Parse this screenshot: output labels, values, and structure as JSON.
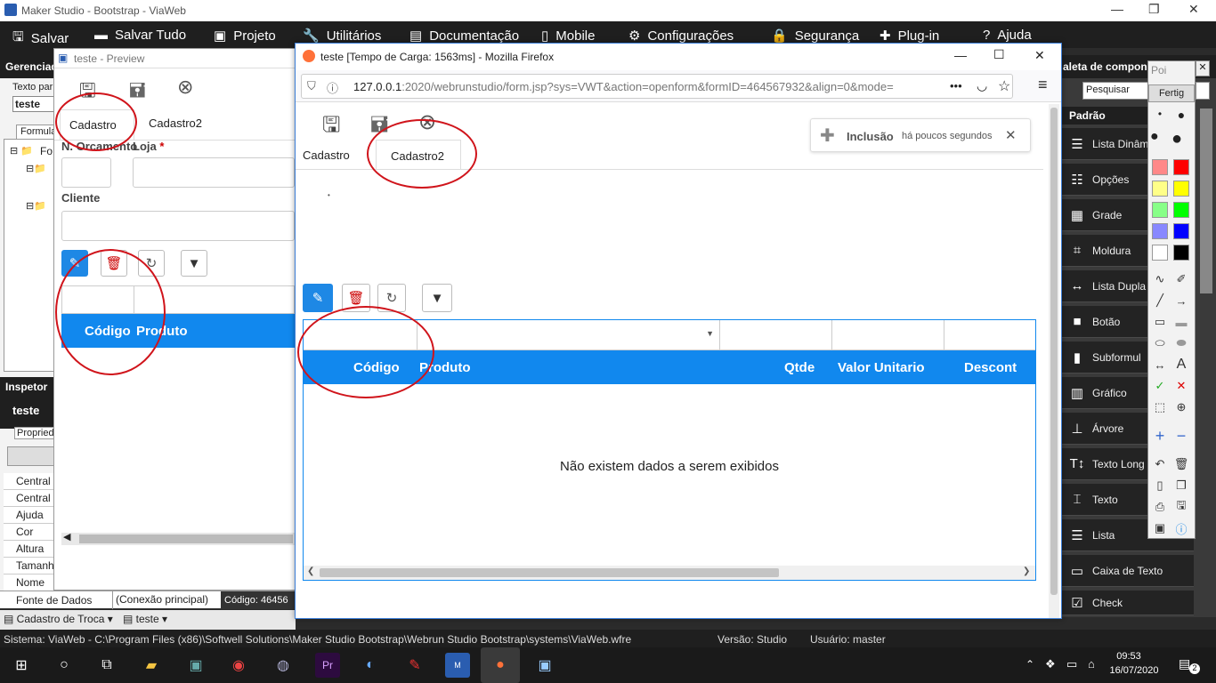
{
  "app": {
    "title": "Maker Studio - Bootstrap - ViaWeb"
  },
  "menu": [
    {
      "label": "Salvar",
      "icon": "save-icon"
    },
    {
      "label": "Salvar Tudo",
      "icon": "save-all-icon"
    },
    {
      "label": "Projeto",
      "icon": "project-icon"
    },
    {
      "label": "Utilitários",
      "icon": "wrench-icon"
    },
    {
      "label": "Documentação",
      "icon": "document-icon"
    },
    {
      "label": "Mobile",
      "icon": "mobile-icon"
    },
    {
      "label": "Configurações",
      "icon": "gear-icon"
    },
    {
      "label": "Segurança",
      "icon": "lock-icon"
    },
    {
      "label": "Plug-in",
      "icon": "puzzle-icon"
    },
    {
      "label": "Ajuda",
      "icon": "help-icon"
    }
  ],
  "left": {
    "manager_label": "Gerenciad",
    "text_label": "Texto par",
    "text_value": "teste",
    "tab": "Formula",
    "tree_root": "Fo",
    "inspector": "Inspetor",
    "inspector_name": "teste",
    "props_tab": "Propried",
    "props": [
      "Central",
      "Central",
      "Ajuda",
      "Cor",
      "Altura",
      "Tamanh",
      "Nome"
    ],
    "datasource_label": "Fonte de Dados",
    "datasource_value": "(Conexão principal)",
    "code_label": "Código:",
    "code_value": "46456"
  },
  "preview": {
    "title": "teste - Preview",
    "tabs": [
      "Cadastro",
      "Cadastro2"
    ],
    "field1": "N. Orcamento",
    "field2": "Loja",
    "required": "*",
    "field3": "Cliente",
    "grid_col1": "Código",
    "grid_col2": "Produto"
  },
  "firefox": {
    "title": "teste [Tempo de Carga: 1563ms] - Mozilla Firefox",
    "url_host": "127.0.0.1",
    "url_rest": ":2020/webrunstudio/form.jsp?sys=VWT&action=openform&formID=464567932&align=0&mode=",
    "url_more": "•••",
    "tabs": [
      "Cadastro",
      "Cadastro2"
    ],
    "toast_title": "Inclusão",
    "toast_time": "há poucos segundos",
    "grid_cols": [
      "Código",
      "Produto",
      "Qtde",
      "Valor Unitario",
      "Descont"
    ],
    "empty_msg": "Não existem dados a serem exibidos",
    "dot": "•"
  },
  "palette_panel": {
    "title": "aleta de compone",
    "section": "Padrão",
    "search_btn": "Pesquisar",
    "items": [
      "Lista Dinâm",
      "Opções",
      "Grade",
      "Moldura",
      "Lista Dupla",
      "Botão",
      "Subformul",
      "Gráfico",
      "Árvore",
      "Texto Long",
      "Texto",
      "Lista",
      "Caixa de Texto",
      "Check"
    ]
  },
  "draw_tool": {
    "label": "Poi",
    "close_btn": "Fertig",
    "text_tool": "A"
  },
  "bottom": {
    "form_tab": "Cadastro de Troca",
    "form_tab2": "teste"
  },
  "status": {
    "system": "Sistema: ViaWeb - C:\\Program Files (x86)\\Softwell Solutions\\Maker Studio Bootstrap\\Webrun Studio Bootstrap\\systems\\ViaWeb.wfre",
    "version": "Versão: Studio",
    "user": "Usuário: master"
  },
  "taskbar": {
    "time": "09:53",
    "date": "16/07/2020",
    "notif": "2"
  },
  "colors": {
    "accent": "#1188ee",
    "annotation": "#d0141b",
    "taskbar": "#1a1a1a"
  }
}
